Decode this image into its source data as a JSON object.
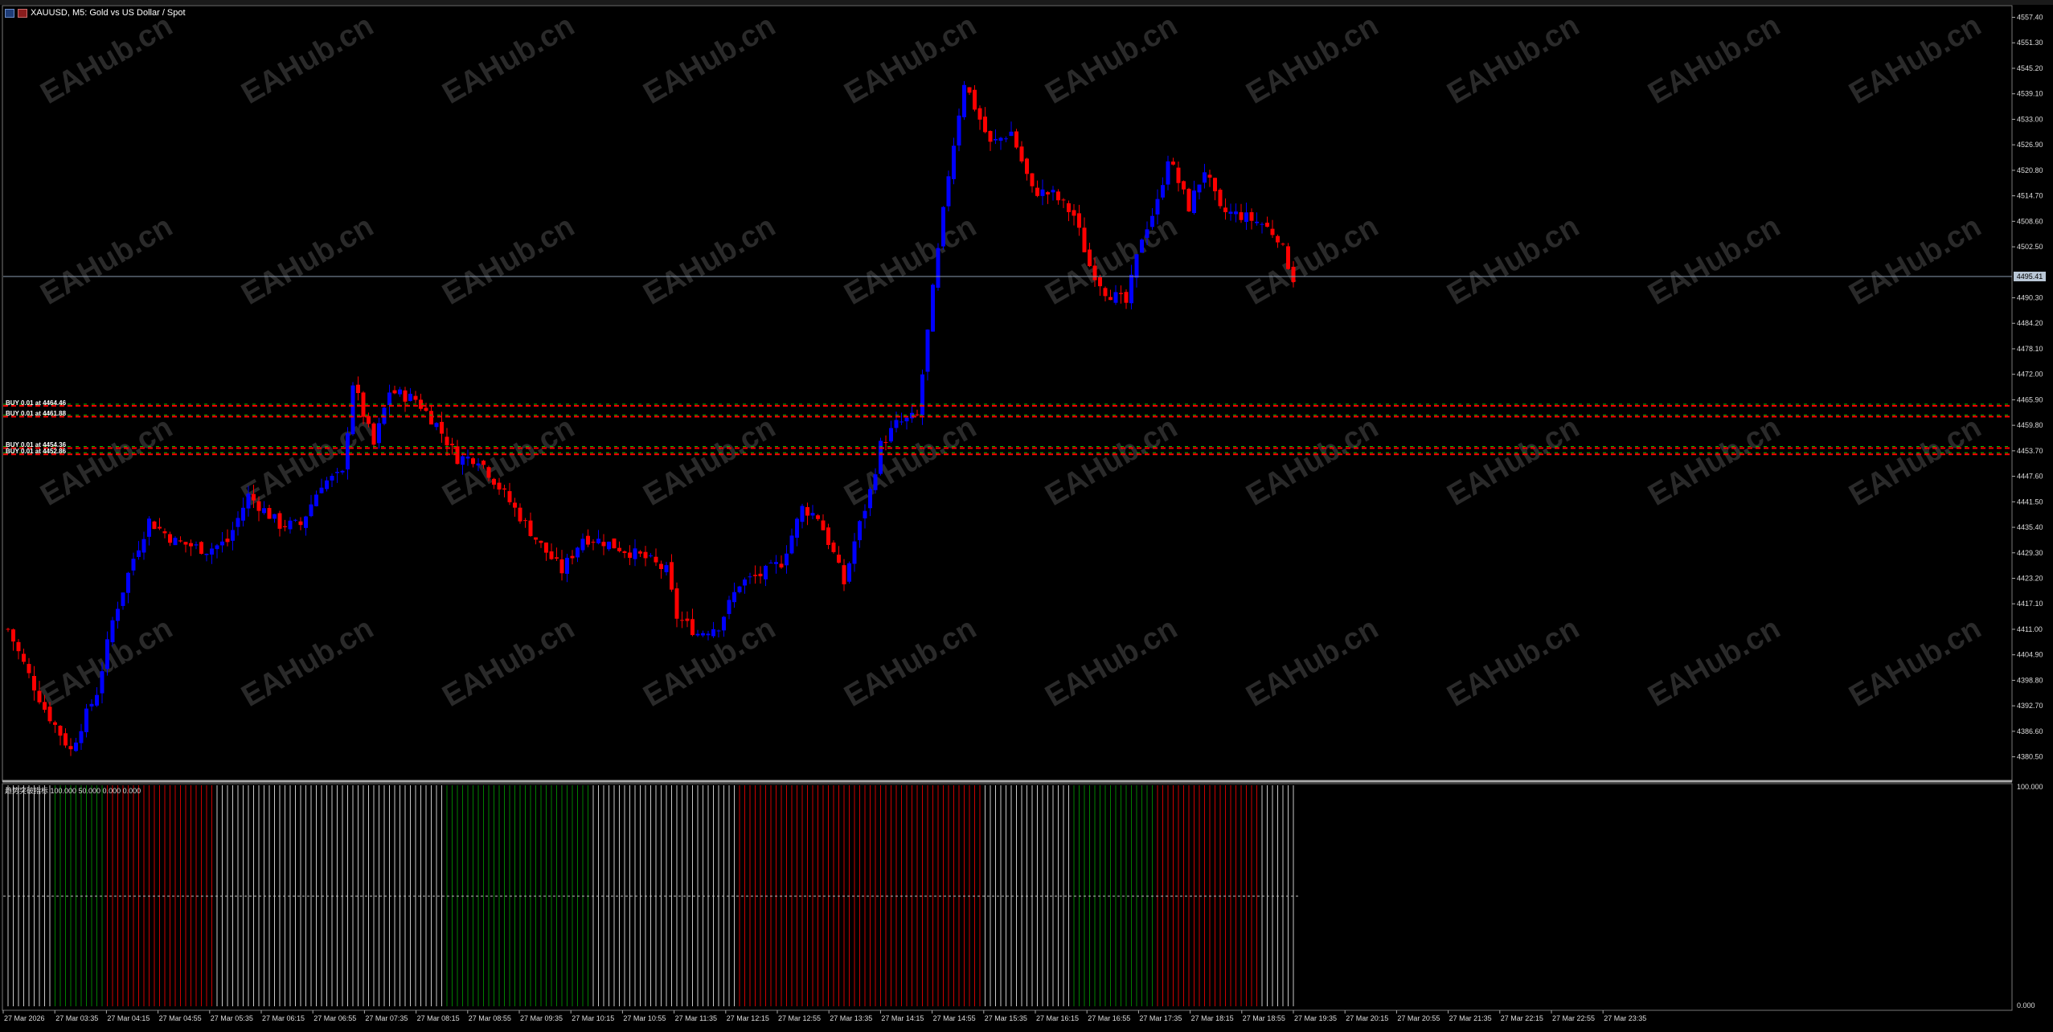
{
  "window": {
    "symbol_title": "XAUUSD, M5:  Gold vs US Dollar / Spot"
  },
  "price_axis": {
    "ticks": [
      "4557.40",
      "4551.30",
      "4545.20",
      "4539.10",
      "4533.00",
      "4526.90",
      "4520.80",
      "4514.70",
      "4508.60",
      "4502.50",
      "4490.30",
      "4484.20",
      "4478.10",
      "4472.00",
      "4465.90",
      "4459.80",
      "4453.70",
      "4447.60",
      "4441.50",
      "4435.40",
      "4429.30",
      "4423.20",
      "4417.10",
      "4411.00",
      "4404.90",
      "4398.80",
      "4392.70",
      "4386.60",
      "4380.50"
    ],
    "current_price_label": "4495.41"
  },
  "time_axis": {
    "ticks": [
      "27 Mar 2026",
      "27 Mar 03:35",
      "27 Mar 04:15",
      "27 Mar 04:55",
      "27 Mar 05:35",
      "27 Mar 06:15",
      "27 Mar 06:55",
      "27 Mar 07:35",
      "27 Mar 08:15",
      "27 Mar 08:55",
      "27 Mar 09:35",
      "27 Mar 10:15",
      "27 Mar 10:55",
      "27 Mar 11:35",
      "27 Mar 12:15",
      "27 Mar 12:55",
      "27 Mar 13:35",
      "27 Mar 14:15",
      "27 Mar 14:55",
      "27 Mar 15:35",
      "27 Mar 16:15",
      "27 Mar 16:55",
      "27 Mar 17:35",
      "27 Mar 18:15",
      "27 Mar 18:55",
      "27 Mar 19:35",
      "27 Mar 20:15",
      "27 Mar 20:55",
      "27 Mar 21:35",
      "27 Mar 22:15",
      "27 Mar 22:55",
      "27 Mar 23:35"
    ]
  },
  "orders": [
    {
      "label": "BUY 0.01 at 4464.46",
      "price": 4464.46
    },
    {
      "label": "BUY 0.01 at 4461.88",
      "price": 4461.88
    },
    {
      "label": "BUY 0.01 at 4454.36",
      "price": 4454.36
    },
    {
      "label": "BUY 0.01 at 4452.86",
      "price": 4452.86
    }
  ],
  "indicator": {
    "label": "趋势突破指标 100.000 50.000 0.000 0.000",
    "axis_top": "100.000",
    "axis_bottom": "0.000",
    "levels": [
      100,
      50,
      0
    ]
  },
  "watermark": "EAHub.cn",
  "colors": {
    "background": "#000000",
    "bull_candle": "#0000ff",
    "bear_candle": "#ff0000",
    "neutral_bar": "#c8c8c8",
    "trend_up_bar": "#008000",
    "trend_down_bar": "#cc0000",
    "grid_line": "#3a3a3a",
    "current_price_line": "#8a9bb0",
    "order_line_green": "#00c000",
    "order_line_red": "#ff0000"
  },
  "chart_data": {
    "type": "candlestick",
    "timeframe": "M5",
    "ylim": [
      4376,
      4560
    ],
    "close_path": [
      {
        "bar": 0,
        "price": 4411
      },
      {
        "bar": 4,
        "price": 4400
      },
      {
        "bar": 7,
        "price": 4392
      },
      {
        "bar": 12,
        "price": 4382
      },
      {
        "bar": 14,
        "price": 4388
      },
      {
        "bar": 17,
        "price": 4396
      },
      {
        "bar": 20,
        "price": 4413
      },
      {
        "bar": 24,
        "price": 4428
      },
      {
        "bar": 27,
        "price": 4437
      },
      {
        "bar": 32,
        "price": 4432
      },
      {
        "bar": 38,
        "price": 4430
      },
      {
        "bar": 42,
        "price": 4432
      },
      {
        "bar": 46,
        "price": 4443
      },
      {
        "bar": 52,
        "price": 4436
      },
      {
        "bar": 56,
        "price": 4436
      },
      {
        "bar": 60,
        "price": 4446
      },
      {
        "bar": 64,
        "price": 4448
      },
      {
        "bar": 66,
        "price": 4470
      },
      {
        "bar": 70,
        "price": 4455
      },
      {
        "bar": 73,
        "price": 4468
      },
      {
        "bar": 78,
        "price": 4466
      },
      {
        "bar": 82,
        "price": 4460
      },
      {
        "bar": 86,
        "price": 4452
      },
      {
        "bar": 90,
        "price": 4452
      },
      {
        "bar": 94,
        "price": 4445
      },
      {
        "bar": 98,
        "price": 4438
      },
      {
        "bar": 102,
        "price": 4431
      },
      {
        "bar": 106,
        "price": 4425
      },
      {
        "bar": 110,
        "price": 4433
      },
      {
        "bar": 114,
        "price": 4432
      },
      {
        "bar": 118,
        "price": 4430
      },
      {
        "bar": 122,
        "price": 4428
      },
      {
        "bar": 126,
        "price": 4425
      },
      {
        "bar": 128,
        "price": 4414
      },
      {
        "bar": 132,
        "price": 4410
      },
      {
        "bar": 136,
        "price": 4412
      },
      {
        "bar": 140,
        "price": 4422
      },
      {
        "bar": 144,
        "price": 4424
      },
      {
        "bar": 148,
        "price": 4427
      },
      {
        "bar": 152,
        "price": 4440
      },
      {
        "bar": 155,
        "price": 4438
      },
      {
        "bar": 158,
        "price": 4429
      },
      {
        "bar": 160,
        "price": 4422
      },
      {
        "bar": 162,
        "price": 4432
      },
      {
        "bar": 165,
        "price": 4444
      },
      {
        "bar": 167,
        "price": 4455
      },
      {
        "bar": 170,
        "price": 4460
      },
      {
        "bar": 174,
        "price": 4462
      },
      {
        "bar": 177,
        "price": 4492
      },
      {
        "bar": 180,
        "price": 4520
      },
      {
        "bar": 183,
        "price": 4542
      },
      {
        "bar": 185,
        "price": 4536
      },
      {
        "bar": 188,
        "price": 4527
      },
      {
        "bar": 192,
        "price": 4530
      },
      {
        "bar": 196,
        "price": 4516
      },
      {
        "bar": 200,
        "price": 4515
      },
      {
        "bar": 204,
        "price": 4510
      },
      {
        "bar": 207,
        "price": 4498
      },
      {
        "bar": 210,
        "price": 4492
      },
      {
        "bar": 214,
        "price": 4489
      },
      {
        "bar": 217,
        "price": 4505
      },
      {
        "bar": 220,
        "price": 4513
      },
      {
        "bar": 222,
        "price": 4524
      },
      {
        "bar": 226,
        "price": 4512
      },
      {
        "bar": 229,
        "price": 4521
      },
      {
        "bar": 232,
        "price": 4511
      },
      {
        "bar": 236,
        "price": 4510
      },
      {
        "bar": 240,
        "price": 4508
      },
      {
        "bar": 243,
        "price": 4505
      },
      {
        "bar": 246,
        "price": 4495
      }
    ],
    "candle_count": 247,
    "indicator_trend_segments": [
      {
        "from": 0,
        "to": 8,
        "state": "neutral"
      },
      {
        "from": 9,
        "to": 18,
        "state": "up"
      },
      {
        "from": 19,
        "to": 39,
        "state": "down"
      },
      {
        "from": 40,
        "to": 83,
        "state": "neutral"
      },
      {
        "from": 84,
        "to": 111,
        "state": "up"
      },
      {
        "from": 112,
        "to": 139,
        "state": "neutral"
      },
      {
        "from": 140,
        "to": 168,
        "state": "down"
      },
      {
        "from": 169,
        "to": 186,
        "state": "down"
      },
      {
        "from": 187,
        "to": 203,
        "state": "neutral"
      },
      {
        "from": 204,
        "to": 219,
        "state": "up"
      },
      {
        "from": 220,
        "to": 239,
        "state": "down"
      },
      {
        "from": 240,
        "to": 246,
        "state": "neutral"
      }
    ]
  }
}
